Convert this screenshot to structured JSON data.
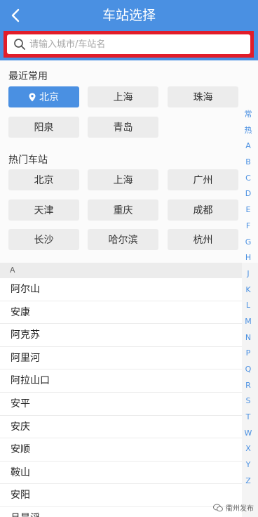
{
  "header": {
    "title": "车站选择"
  },
  "search": {
    "placeholder": "请输入城市/车站名"
  },
  "recent": {
    "title": "最近常用",
    "items": [
      "北京",
      "上海",
      "珠海",
      "阳泉",
      "青岛"
    ],
    "active_index": 0
  },
  "hot": {
    "title": "热门车站",
    "items": [
      "北京",
      "上海",
      "广州",
      "天津",
      "重庆",
      "成都",
      "长沙",
      "哈尔滨",
      "杭州"
    ]
  },
  "index_bar": [
    "常",
    "热",
    "A",
    "B",
    "C",
    "D",
    "E",
    "F",
    "G",
    "H",
    "J",
    "K",
    "L",
    "M",
    "N",
    "P",
    "Q",
    "R",
    "S",
    "T",
    "W",
    "X",
    "Y",
    "Z"
  ],
  "list": {
    "section": "A",
    "stations": [
      "阿尔山",
      "安康",
      "阿克苏",
      "阿里河",
      "阿拉山口",
      "安平",
      "安庆",
      "安顺",
      "鞍山",
      "安阳",
      "旦是淫"
    ]
  },
  "watermark": {
    "text": "衢州发布"
  },
  "colors": {
    "primary": "#4a90e2",
    "highlight_border": "#e11d2a"
  }
}
